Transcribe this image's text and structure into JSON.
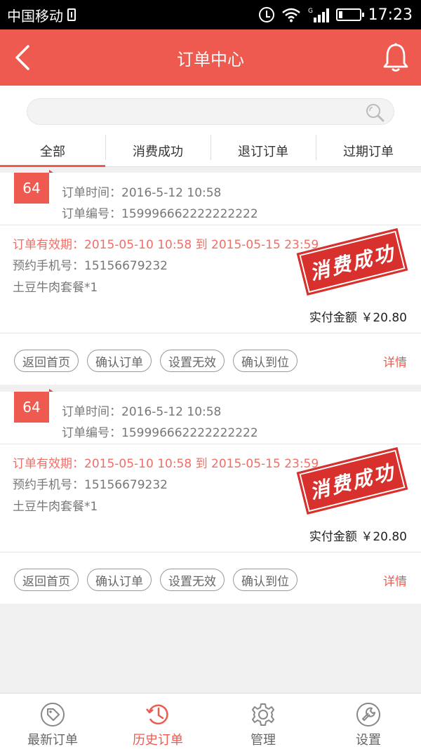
{
  "status_bar": {
    "carrier": "中国移动",
    "network": "G",
    "time": "17:23"
  },
  "header": {
    "title": "订单中心"
  },
  "search": {
    "placeholder": ""
  },
  "tabs": [
    {
      "label": "全部",
      "active": true
    },
    {
      "label": "消费成功",
      "active": false
    },
    {
      "label": "退订订单",
      "active": false
    },
    {
      "label": "过期订单",
      "active": false
    }
  ],
  "orders": [
    {
      "badge": "64",
      "order_time": "订单时间：2016-5-12  10:58",
      "order_no": "订单编号：159996662222222222",
      "validity": "订单有效期：2015-05-10 10:58 到 2015-05-15 23:59",
      "phone": "预约手机号：15156679232",
      "package": "土豆牛肉套餐*1",
      "stamp": "消费成功",
      "paid": "实付金额 ￥20.80",
      "actions": [
        "返回首页",
        "确认订单",
        "设置无效",
        "确认到位"
      ],
      "detail": "详情"
    },
    {
      "badge": "64",
      "order_time": "订单时间：2016-5-12  10:58",
      "order_no": "订单编号：159996662222222222",
      "validity": "订单有效期：2015-05-10 10:58 到 2015-05-15 23:59",
      "phone": "预约手机号：15156679232",
      "package": "土豆牛肉套餐*1",
      "stamp": "消费成功",
      "paid": "实付金额 ￥20.80",
      "actions": [
        "返回首页",
        "确认订单",
        "设置无效",
        "确认到位"
      ],
      "detail": "详情"
    }
  ],
  "bottom_nav": [
    {
      "label": "最新订单",
      "icon": "tag-icon",
      "active": false
    },
    {
      "label": "历史订单",
      "icon": "history-icon",
      "active": true
    },
    {
      "label": "管理",
      "icon": "gear-icon",
      "active": false
    },
    {
      "label": "设置",
      "icon": "wrench-icon",
      "active": false
    }
  ],
  "colors": {
    "accent": "#ee5a50",
    "stamp": "#d8302c",
    "validity_text": "#ee6f67"
  }
}
